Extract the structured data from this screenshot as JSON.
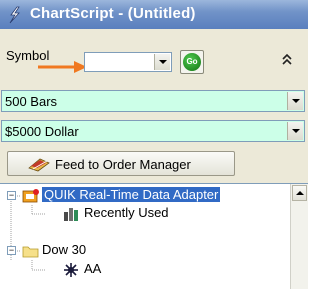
{
  "window": {
    "title": "ChartScript - (Untitled)"
  },
  "symbol": {
    "label": "Symbol",
    "value": "",
    "go_label": "Go"
  },
  "bars_select": {
    "value": "500 Bars"
  },
  "position_select": {
    "value": "$5000 Dollar"
  },
  "feed_button": {
    "label": "Feed to Order Manager"
  },
  "tree": {
    "nodes": [
      {
        "label": "QUIK Real-Time Data Adapter",
        "icon": "data-adapter-icon",
        "expander": "−",
        "selected": true
      },
      {
        "label": "Recently Used",
        "icon": "recently-used-icon"
      },
      {
        "label": "Dow 30",
        "icon": "folder-icon",
        "expander": "−"
      },
      {
        "label": "AA",
        "icon": "stock-icon"
      }
    ]
  },
  "colors": {
    "titlebar": "#5a7fbe",
    "select_bg": "#ccffe8",
    "selection": "#316ac5",
    "go_green": "#137313",
    "arrow": "#f07820"
  }
}
